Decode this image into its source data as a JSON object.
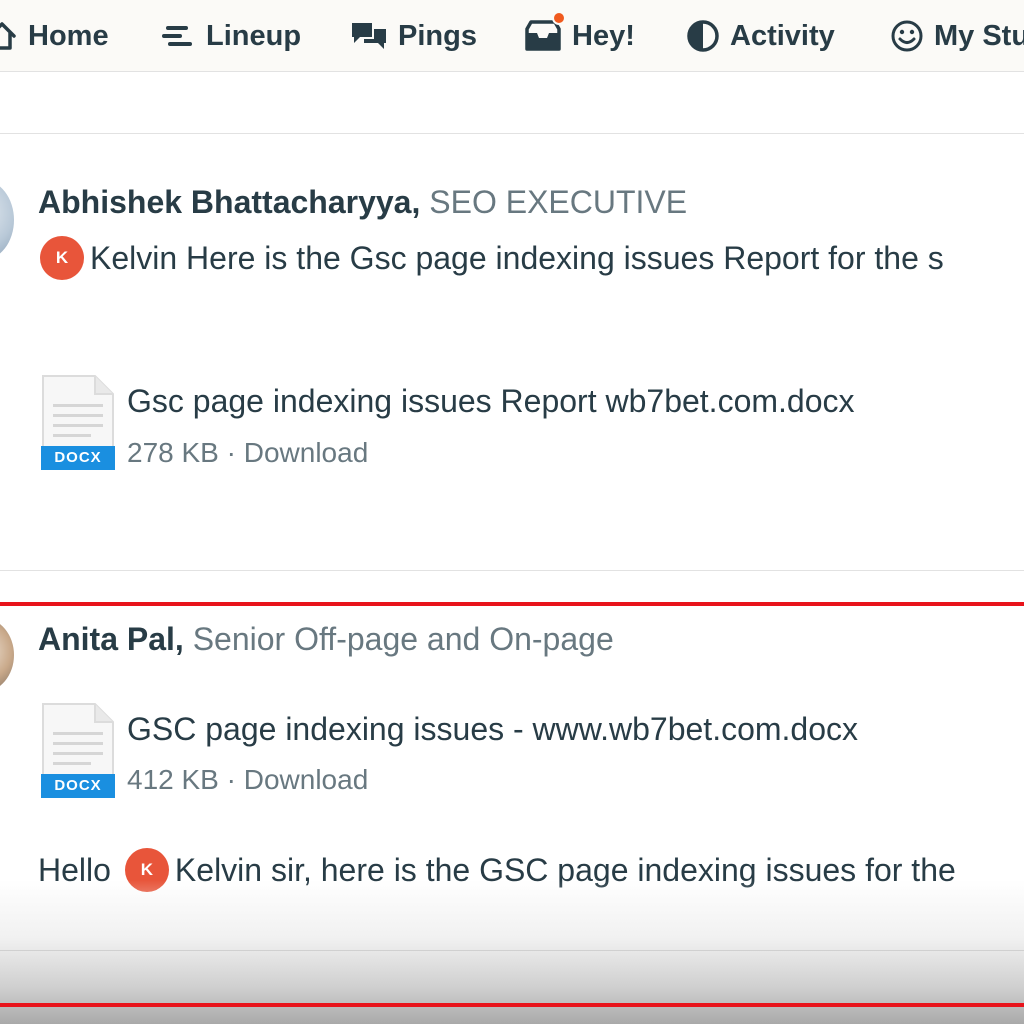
{
  "nav": {
    "home": "Home",
    "lineup": "Lineup",
    "pings": "Pings",
    "hey": "Hey!",
    "activity": "Activity",
    "my_stuff": "My Stu"
  },
  "messages": [
    {
      "author": "Abhishek Bhattacharyya,",
      "title": "SEO EXECUTIVE",
      "mention_initial": "K",
      "text": "Kelvin Here is the Gsc page indexing issues Report for the s",
      "file": {
        "type": "DOCX",
        "name": "Gsc page indexing issues Report wb7bet.com.docx",
        "size": "278 KB",
        "separator": "·",
        "download": "Download"
      }
    },
    {
      "author": "Anita Pal,",
      "title": "Senior Off-page and On-page",
      "file": {
        "type": "DOCX",
        "name": "GSC page indexing issues - www.wb7bet.com.docx",
        "size": "412 KB",
        "separator": "·",
        "download": "Download"
      },
      "text_before": "Hello",
      "mention_initial": "K",
      "text": "Kelvin sir, here is the GSC page indexing issues for the"
    }
  ],
  "colors": {
    "accent_red": "#e8131b",
    "mention": "#e8553a",
    "notification_dot": "#f05a1e",
    "docx_blue": "#1a8fe0",
    "text_dark": "#283c46",
    "text_muted": "#687880"
  }
}
